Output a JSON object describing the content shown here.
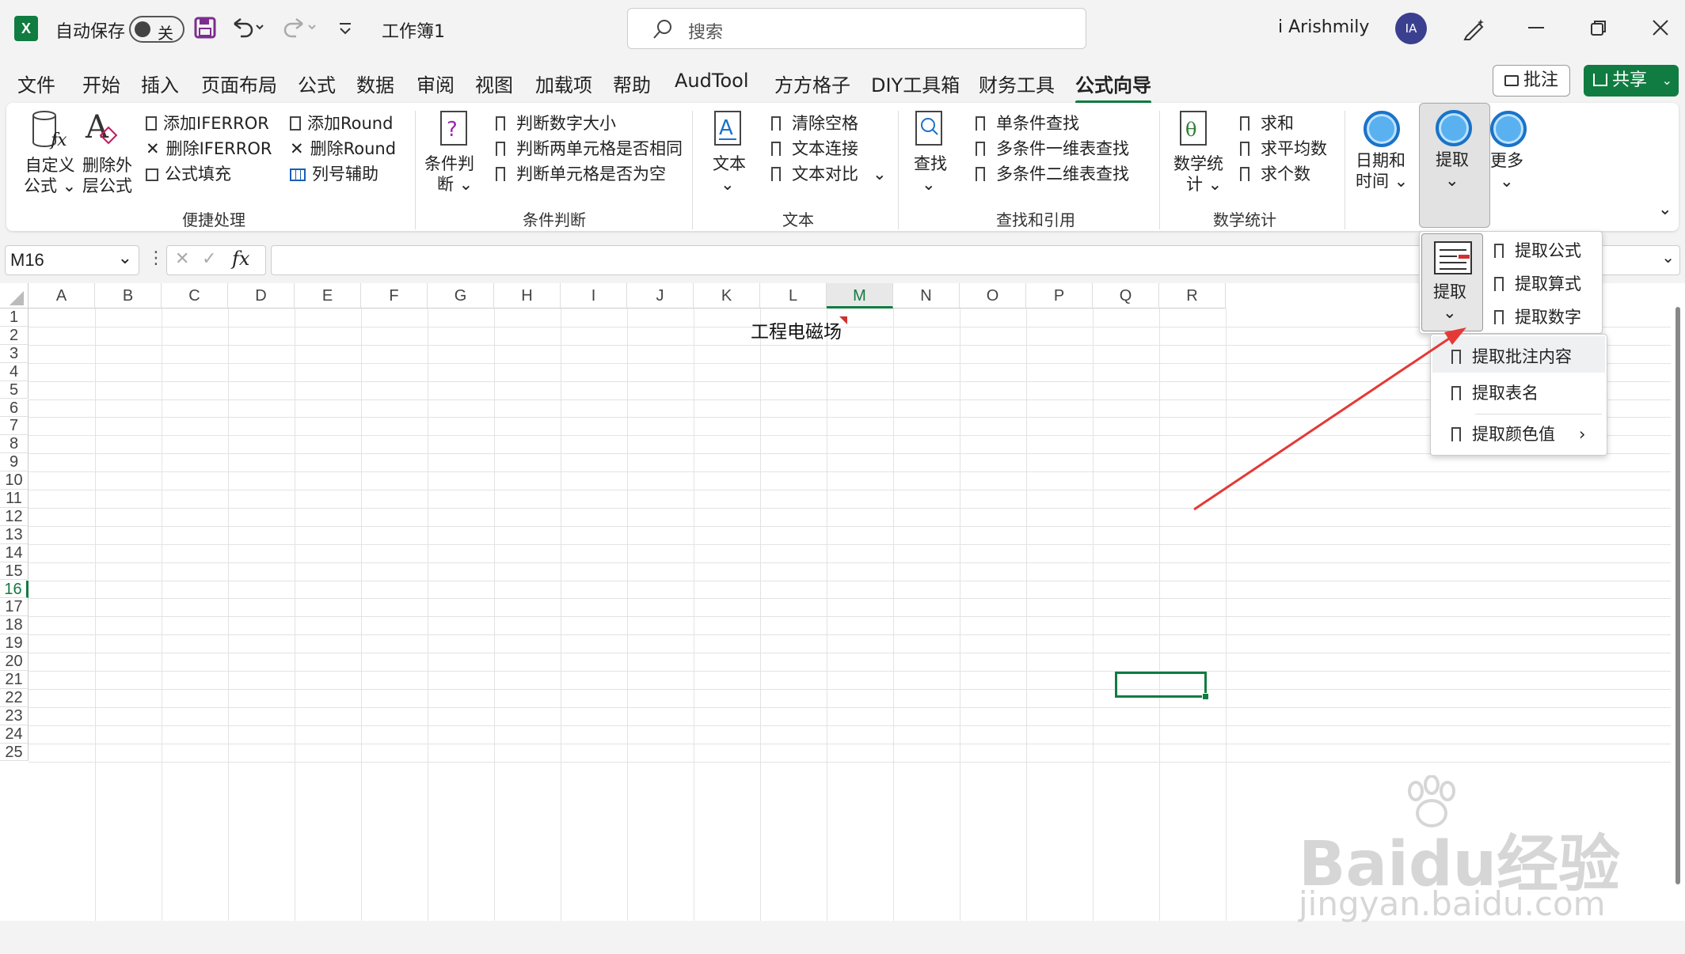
{
  "titlebar": {
    "autosave_label": "自动保存",
    "autosave_state": "关",
    "workbook_title": "工作簿1",
    "search_placeholder": "搜索",
    "username": "i Arishmily",
    "avatar_initials": "IA"
  },
  "tabs": [
    "文件",
    "开始",
    "插入",
    "页面布局",
    "公式",
    "数据",
    "审阅",
    "视图",
    "加载项",
    "帮助",
    "AudTool",
    "方方格子",
    "DIY工具箱",
    "财务工具",
    "公式向导"
  ],
  "active_tab": "公式向导",
  "actions": {
    "comment": "批注",
    "share": "共享"
  },
  "ribbon": {
    "custom_formula": [
      "自定义",
      "公式"
    ],
    "delete_outer": [
      "删除外",
      "层公式"
    ],
    "add_iferror": "添加IFERROR",
    "del_iferror": "删除IFERROR",
    "formula_fill": "公式填充",
    "add_round": "添加Round",
    "del_round": "删除Round",
    "col_assist": "列号辅助",
    "group_quick": "便捷处理",
    "cond_judge": [
      "条件判",
      "断"
    ],
    "judge_num": "判断数字大小",
    "judge_same": "判断两单元格是否相同",
    "judge_empty": "判断单元格是否为空",
    "group_cond": "条件判断",
    "text_btn": "文本",
    "clear_space": "清除空格",
    "text_join": "文本连接",
    "text_compare": "文本对比",
    "group_text": "文本",
    "find_btn": "查找",
    "single_find": "单条件查找",
    "multi_1d": "多条件一维表查找",
    "multi_2d": "多条件二维表查找",
    "group_find": "查找和引用",
    "math_btn": [
      "数学统",
      "计"
    ],
    "sum": "求和",
    "avg": "求平均数",
    "count": "求个数",
    "group_math": "数学统计",
    "date_btn": [
      "日期和",
      "时间"
    ],
    "extract_btn": "提取",
    "more_btn": "更多"
  },
  "formulabar": {
    "namebox": "M16",
    "fx": "fx"
  },
  "grid": {
    "columns": [
      "A",
      "B",
      "C",
      "D",
      "E",
      "F",
      "G",
      "H",
      "I",
      "J",
      "K",
      "L",
      "M",
      "N",
      "O",
      "P",
      "Q",
      "R"
    ],
    "rows": [
      "1",
      "2",
      "3",
      "4",
      "5",
      "6",
      "7",
      "8",
      "9",
      "10",
      "11",
      "12",
      "13",
      "14",
      "15",
      "16",
      "17",
      "18",
      "19",
      "20",
      "21",
      "22",
      "23",
      "24",
      "25"
    ],
    "selected_col": "M",
    "selected_row": "16",
    "cell_i6": "工程电磁场"
  },
  "dropdown1": {
    "big_label": "提取",
    "items": [
      "提取公式",
      "提取算式",
      "提取数字"
    ]
  },
  "dropdown2": {
    "items": [
      "提取批注内容",
      "提取表名",
      "提取颜色值"
    ]
  },
  "watermark": {
    "brand": "Baidu经验",
    "url": "jingyan.baidu.com"
  },
  "colors": {
    "excel_green": "#107c41",
    "arrow_red": "#e53935"
  }
}
